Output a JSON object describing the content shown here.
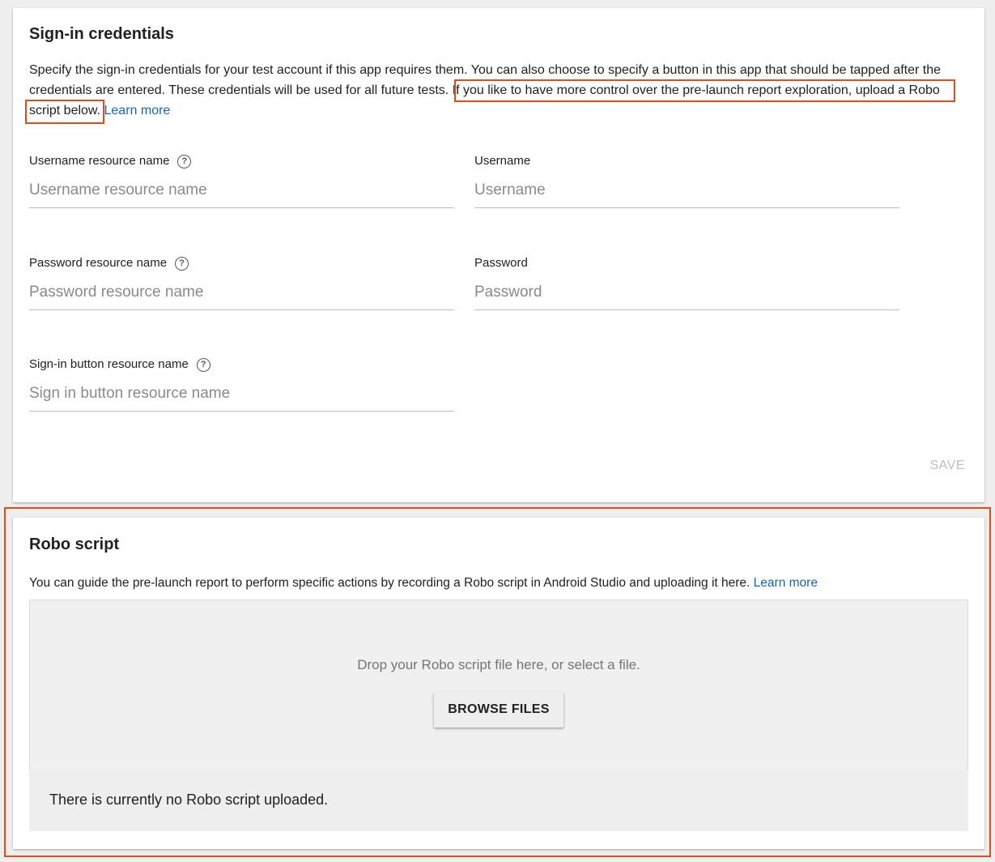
{
  "signin": {
    "title": "Sign-in credentials",
    "description_main": "Specify the sign-in credentials for your test account if this app requires them. You can also choose to specify a button in this app that should be tapped after the credentials are entered. These credentials will be used for all future tests.",
    "description_highlight_1": "If you like to have more control over the pre-launch report exploration, upload a Robo",
    "description_highlight_2": "script below.",
    "learn_more": "Learn more",
    "fields": {
      "username_resource": {
        "label": "Username resource name",
        "placeholder": "Username resource name",
        "value": ""
      },
      "username": {
        "label": "Username",
        "placeholder": "Username",
        "value": ""
      },
      "password_resource": {
        "label": "Password resource name",
        "placeholder": "Password resource name",
        "value": ""
      },
      "password": {
        "label": "Password",
        "placeholder": "Password",
        "value": ""
      },
      "signin_button_resource": {
        "label": "Sign-in button resource name",
        "placeholder": "Sign in button resource name",
        "value": ""
      }
    },
    "help_icon_glyph": "?",
    "save_label": "SAVE"
  },
  "robo": {
    "title": "Robo script",
    "description": "You can guide the pre-launch report to perform specific actions by recording a Robo script in Android Studio and uploading it here.",
    "learn_more": "Learn more",
    "drop_text": "Drop your Robo script file here, or select a file.",
    "browse_label": "BROWSE FILES",
    "status": "There is currently no Robo script uploaded."
  },
  "colors": {
    "link": "#1565c0",
    "annotation": "#e64a19",
    "disabled_text": "#bdbdbd"
  }
}
